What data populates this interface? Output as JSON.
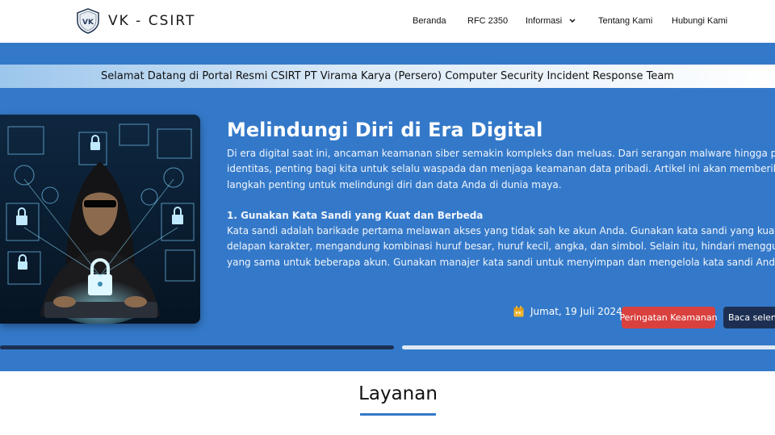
{
  "brand": {
    "name": "VK - CSIRT",
    "logo_text": "VK"
  },
  "nav": {
    "items": [
      {
        "label": "Beranda"
      },
      {
        "label": "RFC 2350"
      },
      {
        "label": "Informasi"
      },
      {
        "label": "Tentang Kami"
      },
      {
        "label": "Hubungi Kami"
      }
    ]
  },
  "ticker": "Selamat Datang di Portal Resmi CSIRT PT Virama Karya (Persero) Computer Security Incident Response Team",
  "article": {
    "title": "Melindungi Diri di Era Digital",
    "lines": [
      "Di era digital saat ini, ancaman keamanan siber semakin kompleks dan meluas. Dari serangan malware hingga pencurian",
      "identitas, penting bagi kita untuk selalu waspada dan menjaga keamanan data pribadi. Artikel ini akan memberikan bebera",
      "langkah penting untuk melindungi diri dan data Anda di dunia maya."
    ],
    "subheading": "1. Gunakan Kata Sandi yang Kuat dan Berbeda",
    "sub_lines": [
      "Kata sandi adalah barikade pertama melawan akses yang tidak sah ke akun Anda. Gunakan kata sandi yang kuat—minimal",
      "delapan karakter, mengandung kombinasi huruf besar, huruf kecil, angka, dan simbol. Selain itu, hindari menggunakan kata",
      "yang sama untuk beberapa akun. Gunakan manajer kata sandi untuk menyimpan dan mengelola kata sandi Anda dengan a"
    ],
    "date": "Jumat, 19 Juli 2024",
    "category": "Peringatan Keamanan",
    "read_more": "Baca selengk"
  },
  "section": {
    "title": "Layanan"
  },
  "colors": {
    "primary": "#3479c9",
    "dark": "#1c2f52",
    "alert": "#d9413f",
    "calendar": "#f2b632"
  },
  "icons": {
    "calendar": "calendar-icon",
    "dropdown": "chevron-down-icon",
    "logo": "shield-logo-icon"
  }
}
